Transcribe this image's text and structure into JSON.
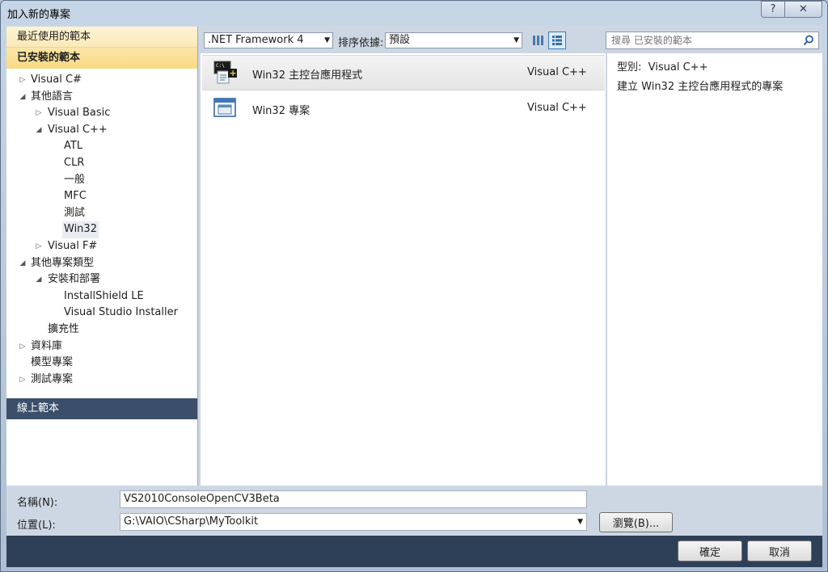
{
  "window": {
    "title": "加入新的專案",
    "help_label": "?",
    "close_label": "✕"
  },
  "nav": {
    "recent_label": "最近使用的範本",
    "installed_label": "已安裝的範本",
    "online_label": "線上範本",
    "tree": [
      {
        "label": "Visual C#",
        "toggle": "▷",
        "depth": 0
      },
      {
        "label": "其他語言",
        "toggle": "◢",
        "depth": 0
      },
      {
        "label": "Visual Basic",
        "toggle": "▷",
        "depth": 1
      },
      {
        "label": "Visual C++",
        "toggle": "◢",
        "depth": 1
      },
      {
        "label": "ATL",
        "toggle": "",
        "depth": 2
      },
      {
        "label": "CLR",
        "toggle": "",
        "depth": 2
      },
      {
        "label": "一般",
        "toggle": "",
        "depth": 2
      },
      {
        "label": "MFC",
        "toggle": "",
        "depth": 2
      },
      {
        "label": "測試",
        "toggle": "",
        "depth": 2
      },
      {
        "label": "Win32",
        "toggle": "",
        "depth": 2,
        "selected": true
      },
      {
        "label": "Visual F#",
        "toggle": "▷",
        "depth": 1
      },
      {
        "label": "其他專案類型",
        "toggle": "◢",
        "depth": 0
      },
      {
        "label": "安裝和部署",
        "toggle": "◢",
        "depth": 1
      },
      {
        "label": "InstallShield LE",
        "toggle": "",
        "depth": 2
      },
      {
        "label": "Visual Studio Installer",
        "toggle": "",
        "depth": 2
      },
      {
        "label": "擴充性",
        "toggle": "",
        "depth": 1
      },
      {
        "label": "資料庫",
        "toggle": "▷",
        "depth": 0
      },
      {
        "label": "模型專案",
        "toggle": "",
        "depth": 0
      },
      {
        "label": "測試專案",
        "toggle": "▷",
        "depth": 0
      }
    ]
  },
  "toolbar": {
    "framework_value": ".NET Framework 4",
    "sort_label": "排序依據:",
    "sort_value": "預設",
    "search_placeholder": "搜尋 已安裝的範本"
  },
  "templates": [
    {
      "name": "Win32 主控台應用程式",
      "lang": "Visual C++",
      "icon": "console-app-icon",
      "selected": true
    },
    {
      "name": "Win32 專案",
      "lang": "Visual C++",
      "icon": "win32-project-icon",
      "selected": false
    }
  ],
  "details": {
    "type_label": "型別:",
    "type_value": "Visual C++",
    "description": "建立 Win32 主控台應用程式的專案"
  },
  "form": {
    "name_label": "名稱(N):",
    "name_value": "VS2010ConsoleOpenCV3Beta",
    "location_label": "位置(L):",
    "location_value": "G:\\VAIO\\CSharp\\MyToolkit",
    "browse_label": "瀏覽(B)..."
  },
  "buttons": {
    "ok_label": "確定",
    "cancel_label": "取消"
  },
  "colors": {
    "selection_gold": "#fbe9b7",
    "footer_navy": "#2e4058",
    "online_header": "#3b4f6b"
  }
}
